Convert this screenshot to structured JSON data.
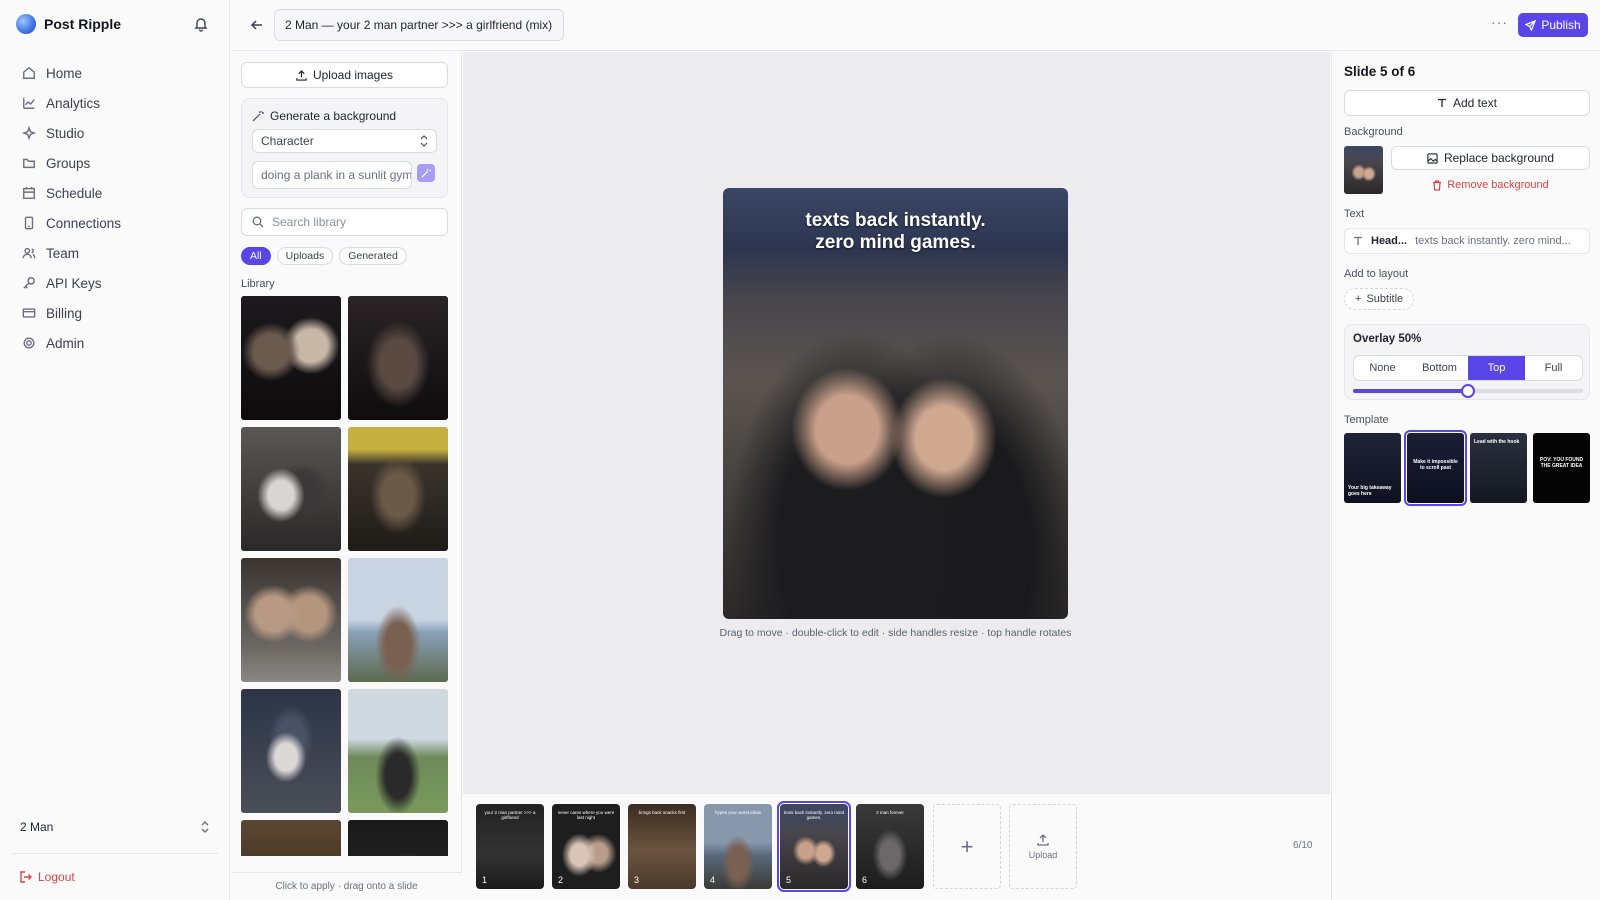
{
  "brand": {
    "name": "Post Ripple"
  },
  "nav": [
    {
      "label": "Home",
      "icon": "home-icon"
    },
    {
      "label": "Analytics",
      "icon": "chart-icon"
    },
    {
      "label": "Studio",
      "icon": "sparkle-icon"
    },
    {
      "label": "Groups",
      "icon": "folder-icon"
    },
    {
      "label": "Schedule",
      "icon": "calendar-icon"
    },
    {
      "label": "Connections",
      "icon": "phone-icon"
    },
    {
      "label": "Team",
      "icon": "users-icon"
    },
    {
      "label": "API Keys",
      "icon": "key-icon"
    },
    {
      "label": "Billing",
      "icon": "card-icon"
    },
    {
      "label": "Admin",
      "icon": "gear-icon"
    }
  ],
  "workspace": {
    "name": "2 Man"
  },
  "logout_label": "Logout",
  "topbar": {
    "title_value": "2 Man — your 2 man partner >>> a girlfriend (mix)",
    "more_label": "···",
    "publish_label": "Publish"
  },
  "library": {
    "upload_label": "Upload images",
    "generate_title": "Generate a background",
    "generate_select": "Character",
    "generate_prompt": "doing a plank in a sunlit gym",
    "search_placeholder": "Search library",
    "filters": [
      "All",
      "Uploads",
      "Generated"
    ],
    "active_filter": "All",
    "section_label": "Library",
    "footer_hint": "Click to apply · drag onto a slide"
  },
  "canvas": {
    "slide_caption_line1": "texts back instantly.",
    "slide_caption_line2": "zero mind games.",
    "hint": "Drag to move · double-click to edit · side handles resize · top handle rotates"
  },
  "filmstrip": {
    "frames": [
      {
        "num": "1",
        "caption": "your 2 man partner >>> a girlfriend"
      },
      {
        "num": "2",
        "caption": "never cares where you were last night"
      },
      {
        "num": "3",
        "caption": "brings back snacks first"
      },
      {
        "num": "4",
        "caption": "hypes your worst ideas"
      },
      {
        "num": "5",
        "caption": "texts back instantly. zero mind games."
      },
      {
        "num": "6",
        "caption": "2 man forever"
      }
    ],
    "selected": 5,
    "upload_label": "Upload",
    "count": "6/10"
  },
  "right": {
    "slide_title": "Slide 5 of 6",
    "add_text_label": "Add text",
    "background_label": "Background",
    "replace_label": "Replace background",
    "remove_label": "Remove background",
    "text_label": "Text",
    "text_kind": "Head...",
    "text_value": "texts back instantly. zero mind...",
    "add_layout_label": "Add to layout",
    "subtitle_label": "Subtitle",
    "overlay_label": "Overlay 50%",
    "overlay_value": 0.5,
    "overlay_options": [
      "None",
      "Bottom",
      "Top",
      "Full"
    ],
    "overlay_active": "Top",
    "template_label": "Template",
    "templates": [
      {
        "text": "Your big takeaway goes here"
      },
      {
        "text": "Make it impossible to scroll past"
      },
      {
        "text": "Lead with the hook"
      },
      {
        "text": "POV: YOU FOUND THE GREAT IDEA"
      }
    ],
    "template_selected": 2
  },
  "colors": {
    "accent": "#5a45e8",
    "danger": "#d64545"
  }
}
